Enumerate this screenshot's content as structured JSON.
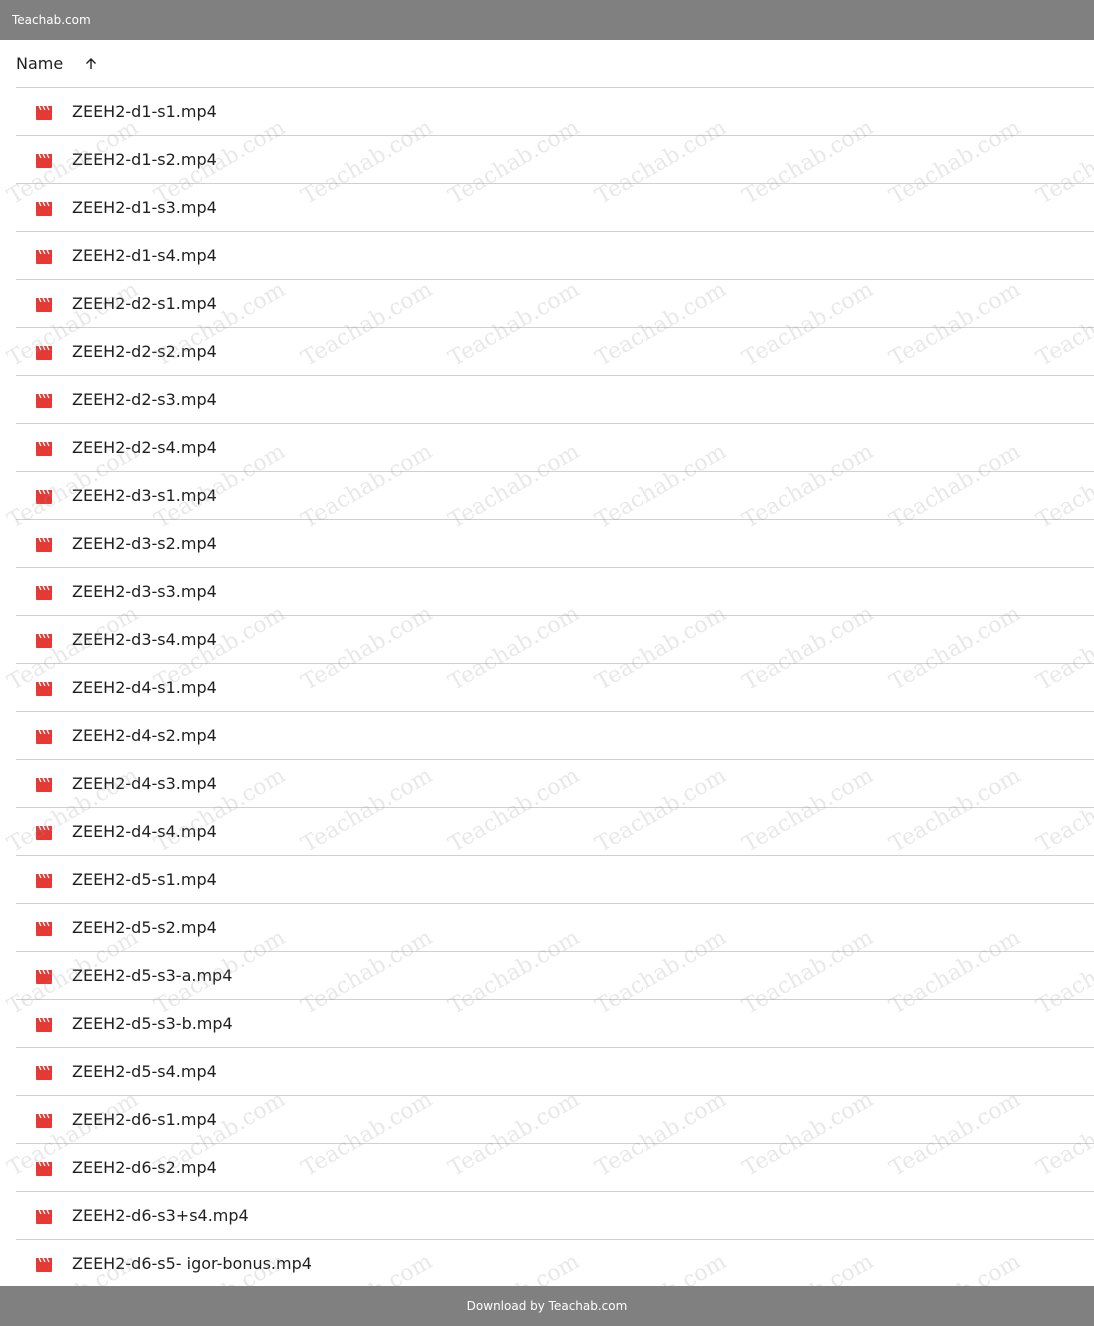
{
  "top_bar": {
    "title": "Teachab.com"
  },
  "list": {
    "column_header": "Name",
    "sort_icon": "arrow-up-icon",
    "file_icon": "video-file-icon",
    "file_icon_color": "#e53935",
    "files": [
      "ZEEH2-d1-s1.mp4",
      "ZEEH2-d1-s2.mp4",
      "ZEEH2-d1-s3.mp4",
      "ZEEH2-d1-s4.mp4",
      "ZEEH2-d2-s1.mp4",
      "ZEEH2-d2-s2.mp4",
      "ZEEH2-d2-s3.mp4",
      "ZEEH2-d2-s4.mp4",
      "ZEEH2-d3-s1.mp4",
      "ZEEH2-d3-s2.mp4",
      "ZEEH2-d3-s3.mp4",
      "ZEEH2-d3-s4.mp4",
      "ZEEH2-d4-s1.mp4",
      "ZEEH2-d4-s2.mp4",
      "ZEEH2-d4-s3.mp4",
      "ZEEH2-d4-s4.mp4",
      "ZEEH2-d5-s1.mp4",
      "ZEEH2-d5-s2.mp4",
      "ZEEH2-d5-s3-a.mp4",
      "ZEEH2-d5-s3-b.mp4",
      "ZEEH2-d5-s4.mp4",
      "ZEEH2-d6-s1.mp4",
      "ZEEH2-d6-s2.mp4",
      "ZEEH2-d6-s3+s4.mp4",
      "ZEEH2-d6-s5- igor-bonus.mp4"
    ]
  },
  "watermark": {
    "text": "Teachab.com"
  },
  "bottom_bar": {
    "text": "Download by Teachab.com"
  }
}
